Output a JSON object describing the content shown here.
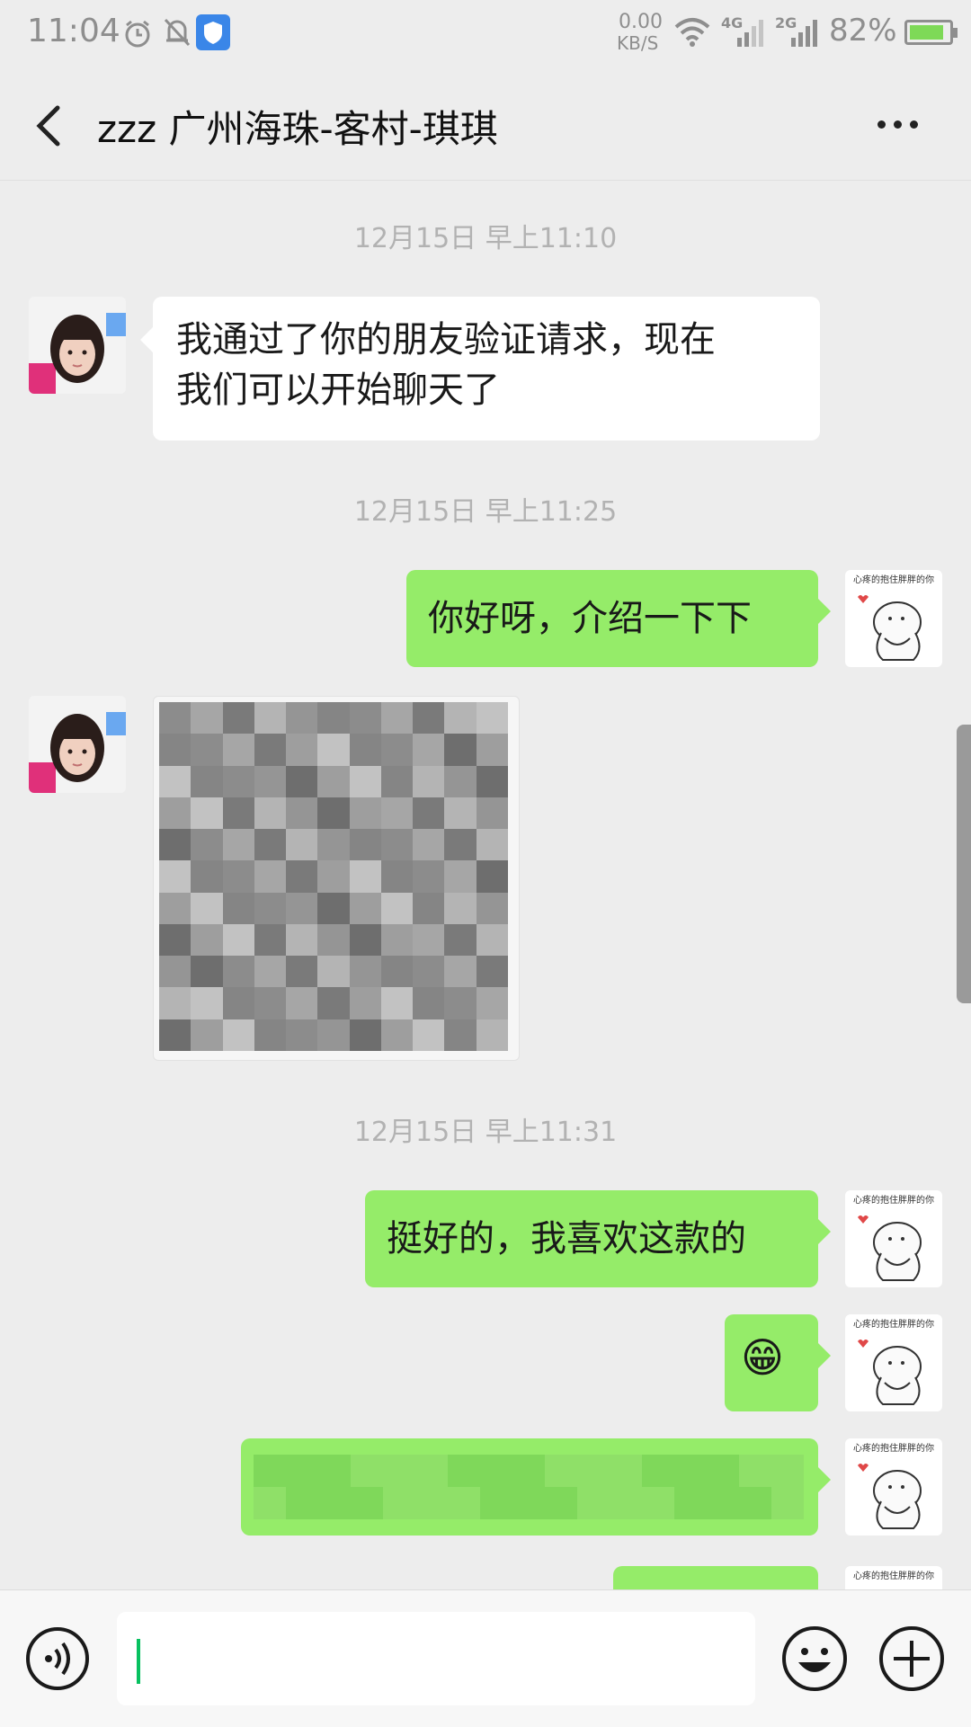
{
  "status_bar": {
    "time": "11:04",
    "net_speed_value": "0.00",
    "net_speed_unit": "KB/S",
    "sim1_label": "4G",
    "sim2_label": "2G",
    "battery": "82%",
    "battery_level": 0.82,
    "icons": [
      "alarm-icon",
      "mute-bell-icon",
      "shield-app-icon",
      "wifi-icon",
      "signal-icon"
    ]
  },
  "header": {
    "title": "zzz 广州海珠-客村-琪琪",
    "back_icon": "chevron-left-icon",
    "more_icon": "more-dots-icon"
  },
  "messages": [
    {
      "type": "timestamp",
      "text": "12月15日 早上11:10"
    },
    {
      "type": "text",
      "from": "contact",
      "lines": [
        "我通过了你的朋友验证请求，现在",
        "我们可以开始聊天了"
      ]
    },
    {
      "type": "timestamp",
      "text": "12月15日 早上11:25"
    },
    {
      "type": "text",
      "from": "me",
      "text": "你好呀，介绍一下下"
    },
    {
      "type": "image",
      "from": "contact",
      "note": "blurred"
    },
    {
      "type": "timestamp",
      "text": "12月15日 早上11:31"
    },
    {
      "type": "text",
      "from": "me",
      "text": "挺好的，我喜欢这款的"
    },
    {
      "type": "emoji",
      "from": "me",
      "emoji": "😁"
    },
    {
      "type": "blurred_text",
      "from": "me"
    },
    {
      "type": "partial",
      "from": "me"
    }
  ],
  "me_avatar_caption": "心疼的抱住胖胖的你",
  "input": {
    "placeholder": "",
    "value": ""
  },
  "colors": {
    "background": "#ededed",
    "outgoing_bubble": "#95ec69",
    "incoming_bubble": "#ffffff",
    "cursor": "#07c160"
  }
}
